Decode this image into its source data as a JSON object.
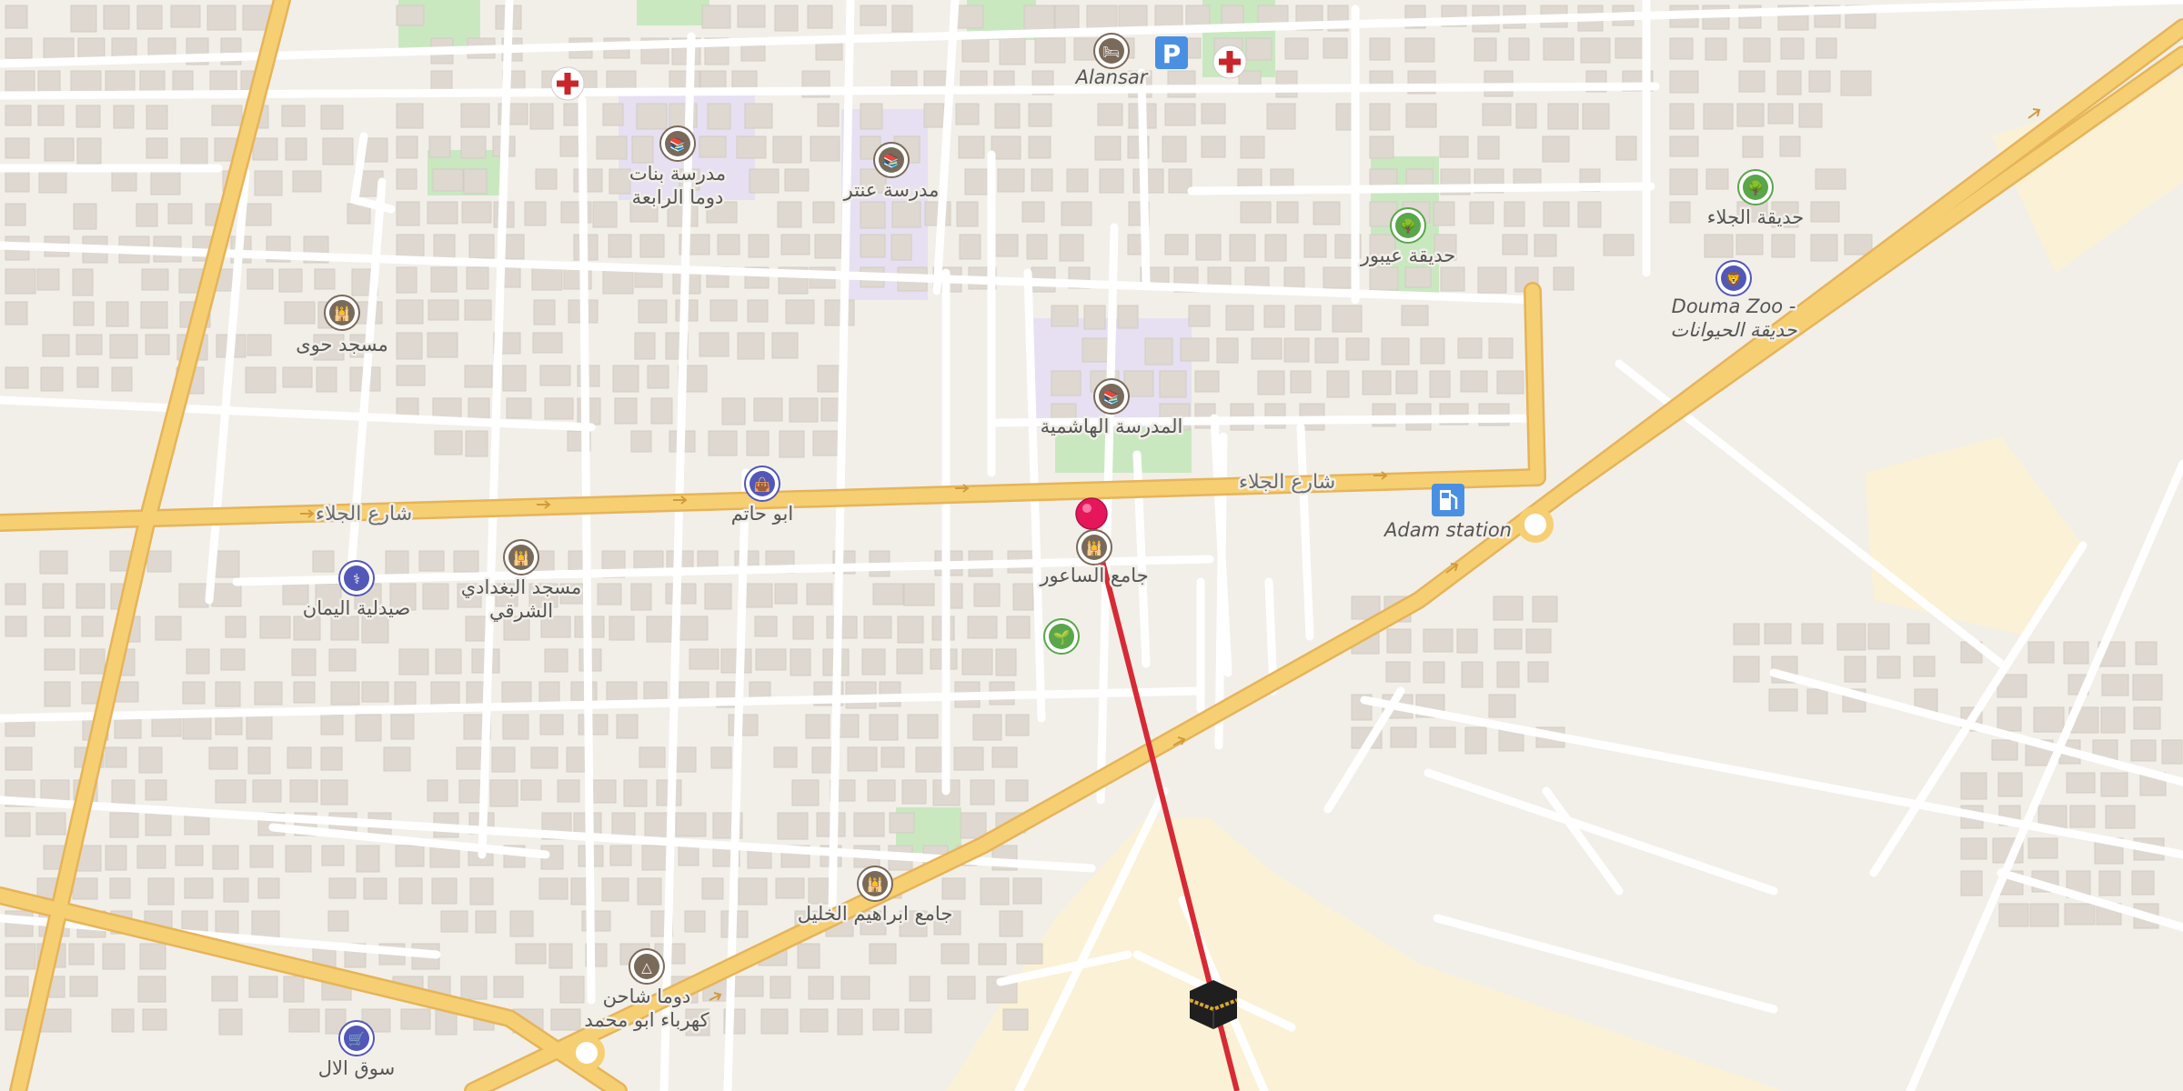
{
  "map": {
    "colors": {
      "background": "#f2efe9",
      "block": "#e9e4de",
      "building": "#ded8d1",
      "park": "#c9e8c0",
      "school": "#e6e0f2",
      "sand": "#fbf1d6",
      "minor_road": "#ffffff",
      "major_road": "#f6cf73",
      "major_road_edge": "#e6b45a",
      "route": "#d62a35",
      "pin": "#e5175a"
    },
    "streets": [
      {
        "id": "jalaa-west",
        "label": "شارع الجلاء"
      },
      {
        "id": "jalaa-east",
        "label": "شارع الجلاء"
      }
    ],
    "pois": [
      {
        "id": "alansar",
        "icon": "hotel-icon",
        "label": "Alansar",
        "italic": true
      },
      {
        "id": "parking",
        "icon": "parking-icon",
        "label": ""
      },
      {
        "id": "pharmacy-top-left",
        "icon": "medical-cross-icon",
        "label": ""
      },
      {
        "id": "pharmacy-top",
        "icon": "medical-cross-icon",
        "label": ""
      },
      {
        "id": "girls-school",
        "icon": "school-icon",
        "label": "مدرسة بنات",
        "label2": "دوما الرابعة"
      },
      {
        "id": "antar-school",
        "icon": "school-icon",
        "label": "مدرسة عنتر"
      },
      {
        "id": "jalaa-park",
        "icon": "park-tree-icon",
        "label": "حديقة الجلاء"
      },
      {
        "id": "eibour-park",
        "icon": "park-tree-icon",
        "label": "حديقة عيبور"
      },
      {
        "id": "douma-zoo",
        "icon": "zoo-icon",
        "label": "Douma Zoo -",
        "label2": "حديقة الحيوانات",
        "italic": true
      },
      {
        "id": "hawi-mosque",
        "icon": "mosque-icon",
        "label": "مسجد حوى"
      },
      {
        "id": "hashemia-school",
        "icon": "school-icon",
        "label": "المدرسة الهاشمية"
      },
      {
        "id": "abu-hatem",
        "icon": "shopping-bag-icon",
        "label": "ابو حاتم"
      },
      {
        "id": "adam-station",
        "icon": "fuel-icon",
        "label": "Adam station",
        "italic": true
      },
      {
        "id": "baghdadi-mosque",
        "icon": "mosque-icon",
        "label": "مسجد البغدادي",
        "label2": "الشرقي"
      },
      {
        "id": "yaman-pharmacy",
        "icon": "pharmacy-icon",
        "label": "صيدلية اليمان"
      },
      {
        "id": "saour-mosque",
        "icon": "mosque-icon",
        "label": "جامع الساعور"
      },
      {
        "id": "garden-center",
        "icon": "garden-icon",
        "label": ""
      },
      {
        "id": "ibrahim-mosque",
        "icon": "mosque-icon",
        "label": "جامع ابراهيم الخليل"
      },
      {
        "id": "douma-shahin",
        "icon": "shelter-icon",
        "label": "دوما شاحن",
        "label2": "كهرباء ابو محمد"
      },
      {
        "id": "al-al-market",
        "icon": "shopping-cart-icon",
        "label": "سوق الال"
      },
      {
        "id": "qibla",
        "icon": "kaaba-icon",
        "label": ""
      },
      {
        "id": "location-pin",
        "icon": "location-pin-icon",
        "label": ""
      }
    ],
    "route": {
      "label": "qibla direction line"
    }
  }
}
